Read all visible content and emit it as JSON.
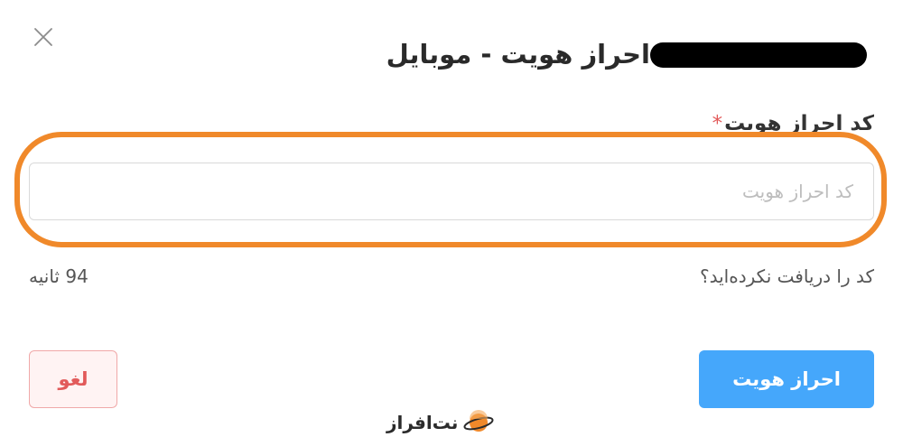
{
  "dialog": {
    "title": "احراز هویت - موبایل",
    "close_icon": "close-icon"
  },
  "field": {
    "label": "کد احراز هویت",
    "required_mark": "*",
    "value": "",
    "placeholder": "کد احراز هویت"
  },
  "resend": {
    "prompt": "کد را دریافت نکرده‌اید؟",
    "countdown": "94 ثانیه"
  },
  "actions": {
    "submit_label": "احراز هویت",
    "cancel_label": "لغو"
  },
  "brand": {
    "name": "نت‌افراز",
    "logo_icon": "planet-logo-icon"
  },
  "colors": {
    "primary": "#45a7fb",
    "danger": "#e25a5a",
    "highlight": "#f0892a"
  }
}
